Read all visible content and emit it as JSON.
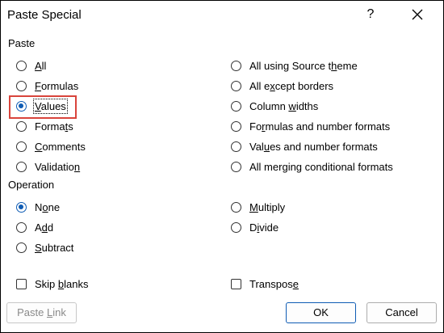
{
  "dialog": {
    "title": "Paste Special",
    "help_label": "?"
  },
  "paste": {
    "heading": "Paste",
    "left": [
      {
        "pre": "",
        "key": "A",
        "post": "ll",
        "selected": false
      },
      {
        "pre": "",
        "key": "F",
        "post": "ormulas",
        "selected": false
      },
      {
        "pre": "",
        "key": "V",
        "post": "alues",
        "selected": true
      },
      {
        "pre": "Forma",
        "key": "t",
        "post": "s",
        "selected": false
      },
      {
        "pre": "",
        "key": "C",
        "post": "omments",
        "selected": false
      },
      {
        "pre": "Validatio",
        "key": "n",
        "post": "",
        "selected": false
      }
    ],
    "right": [
      {
        "pre": "All using Source t",
        "key": "h",
        "post": "eme",
        "selected": false
      },
      {
        "pre": "All e",
        "key": "x",
        "post": "cept borders",
        "selected": false
      },
      {
        "pre": "Column ",
        "key": "w",
        "post": "idths",
        "selected": false
      },
      {
        "pre": "Fo",
        "key": "r",
        "post": "mulas and number formats",
        "selected": false
      },
      {
        "pre": "Val",
        "key": "u",
        "post": "es and number formats",
        "selected": false
      },
      {
        "pre": "All mer",
        "key": "g",
        "post": "ing conditional formats",
        "selected": false
      }
    ]
  },
  "operation": {
    "heading": "Operation",
    "left": [
      {
        "pre": "N",
        "key": "o",
        "post": "ne",
        "selected": true
      },
      {
        "pre": "A",
        "key": "d",
        "post": "d",
        "selected": false
      },
      {
        "pre": "",
        "key": "S",
        "post": "ubtract",
        "selected": false
      }
    ],
    "right": [
      {
        "pre": "",
        "key": "M",
        "post": "ultiply",
        "selected": false
      },
      {
        "pre": "D",
        "key": "i",
        "post": "vide",
        "selected": false
      }
    ]
  },
  "checks": {
    "skip_blanks": {
      "pre": "Skip ",
      "key": "b",
      "post": "lanks",
      "checked": false
    },
    "transpose": {
      "pre": "Transpos",
      "key": "e",
      "post": "",
      "checked": false
    }
  },
  "buttons": {
    "paste_link": {
      "pre": "Paste ",
      "key": "L",
      "post": "ink"
    },
    "ok": "OK",
    "cancel": "Cancel"
  },
  "colors": {
    "accent": "#0f5cb4",
    "highlight": "#d9443c"
  }
}
